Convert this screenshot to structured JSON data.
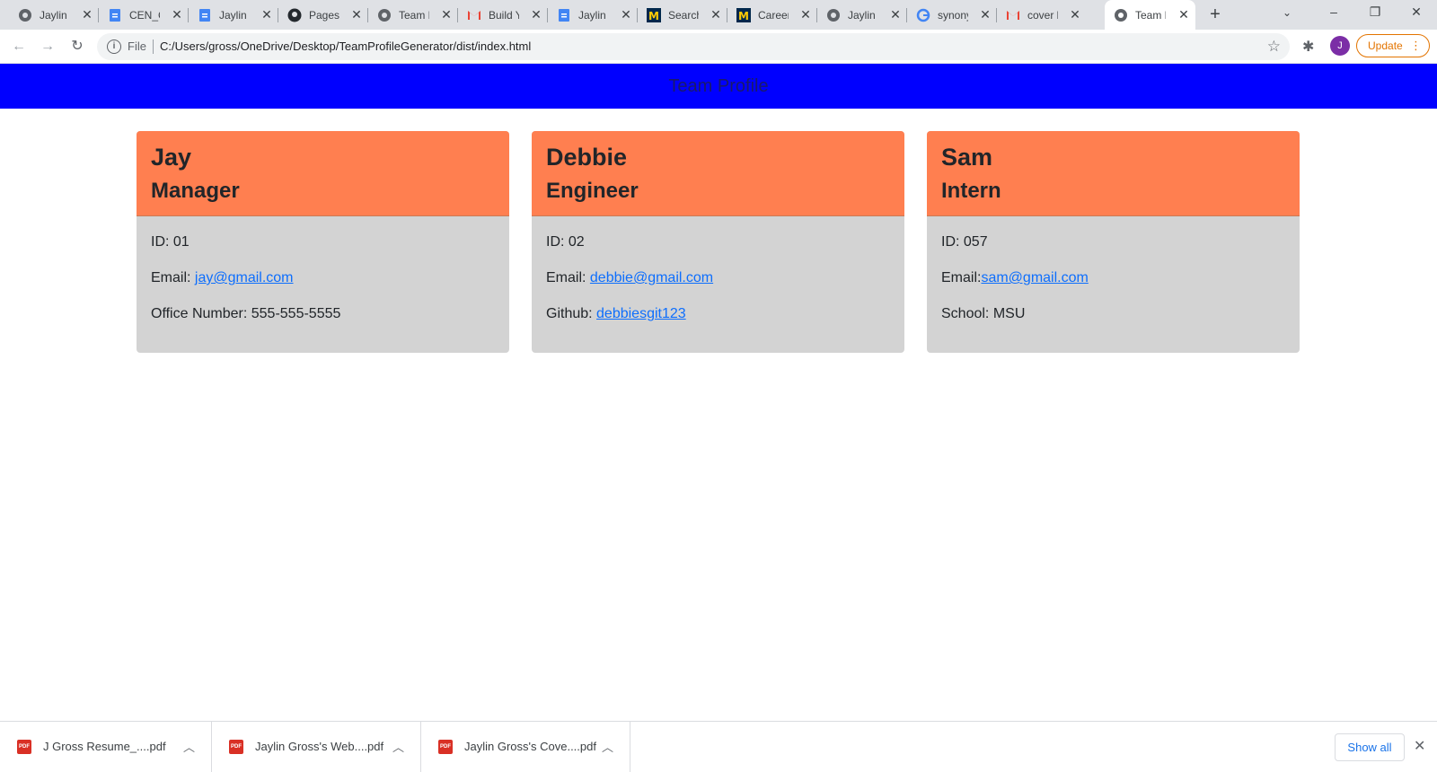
{
  "browser": {
    "tabs": [
      {
        "title": "Jaylin C",
        "icon": "globe-icon"
      },
      {
        "title": "CEN_C",
        "icon": "docs-icon"
      },
      {
        "title": "Jaylin G",
        "icon": "docs-icon"
      },
      {
        "title": "Pages",
        "icon": "github-icon"
      },
      {
        "title": "Team P",
        "icon": "globe-icon"
      },
      {
        "title": "Build Y",
        "icon": "gmail-icon"
      },
      {
        "title": "Jaylin G",
        "icon": "docs-icon"
      },
      {
        "title": "Search",
        "icon": "umich-icon"
      },
      {
        "title": "Career",
        "icon": "umich-icon"
      },
      {
        "title": "Jaylin C",
        "icon": "globe-icon"
      },
      {
        "title": "synony",
        "icon": "google-icon"
      },
      {
        "title": "cover l",
        "icon": "gmail-icon"
      },
      {
        "title": "Team P",
        "icon": "globe-icon",
        "active": true
      }
    ],
    "address_scheme": "File",
    "url": "C:/Users/gross/OneDrive/Desktop/TeamProfileGenerator/dist/index.html",
    "profile_initial": "J",
    "update_label": "Update"
  },
  "page": {
    "banner_title": "Team Profile",
    "banner_color": "#0000ff",
    "card_header_color": "#ff7f50",
    "card_body_color": "#d3d3d3",
    "employees": [
      {
        "name": "Jay",
        "role": "Manager",
        "id_label": "ID: 01",
        "email_label": "Email: ",
        "email": "jay@gmail.com",
        "extra_label": "Office Number: 555-555-5555",
        "extra_link": ""
      },
      {
        "name": "Debbie",
        "role": "Engineer",
        "id_label": "ID: 02",
        "email_label": "Email: ",
        "email": "debbie@gmail.com",
        "extra_label": "Github: ",
        "extra_link": "debbiesgit123"
      },
      {
        "name": "Sam",
        "role": "Intern",
        "id_label": "ID: 057",
        "email_label": "Email:",
        "email": "sam@gmail.com",
        "extra_label": "School: MSU",
        "extra_link": ""
      }
    ]
  },
  "downloads": {
    "items": [
      {
        "name": "J Gross Resume_....pdf"
      },
      {
        "name": "Jaylin Gross's Web....pdf"
      },
      {
        "name": "Jaylin Gross's Cove....pdf"
      }
    ],
    "show_all_label": "Show all"
  }
}
